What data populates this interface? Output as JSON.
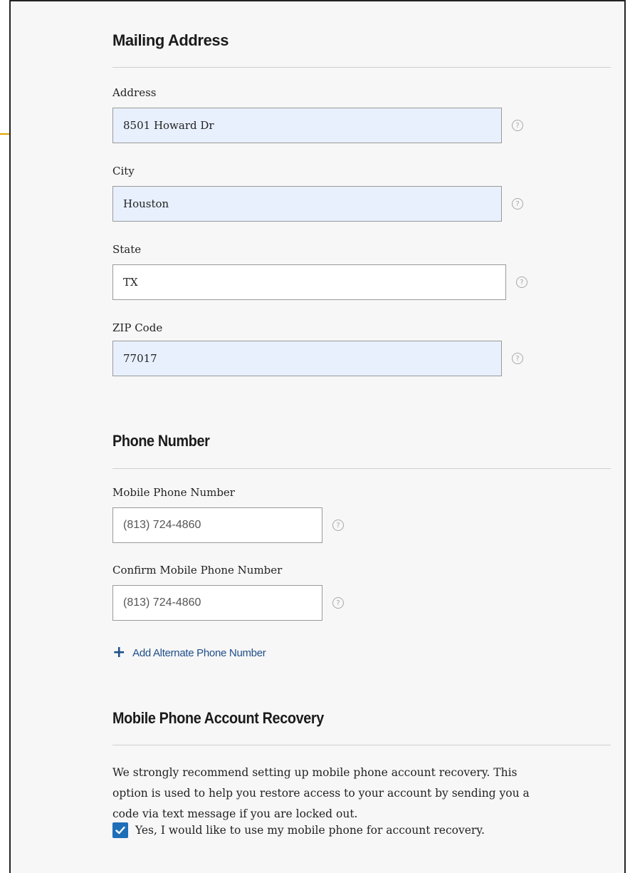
{
  "mailing": {
    "title": "Mailing Address",
    "address_label": "Address",
    "address_value": "8501 Howard Dr",
    "city_label": "City",
    "city_value": "Houston",
    "state_label": "State",
    "state_value": "TX",
    "zip_label": "ZIP Code",
    "zip_value": "77017"
  },
  "phone": {
    "title": "Phone Number",
    "mobile_label": "Mobile Phone Number",
    "mobile_value": "(813) 724-4860",
    "confirm_label": "Confirm Mobile Phone Number",
    "confirm_value": "(813) 724-4860",
    "add_alternate_label": "Add Alternate Phone Number"
  },
  "recovery": {
    "title": "Mobile Phone Account Recovery",
    "description_lines": [
      "We strongly recommend setting up mobile phone account recovery. This",
      "option is used to help you restore access to your account by sending you a",
      "code via text message if you are locked out."
    ],
    "checkbox_label": "Yes, I would like to use my mobile phone for account recovery.",
    "checkbox_checked": true
  },
  "icons": {
    "help": "help-circle-icon",
    "add": "plus-icon",
    "check": "checkmark-icon"
  },
  "colors": {
    "autofill_bg": "#e8f0fe",
    "link": "#1f4f8a",
    "checkbox": "#1f6fb8",
    "accent": "#e0a100"
  }
}
